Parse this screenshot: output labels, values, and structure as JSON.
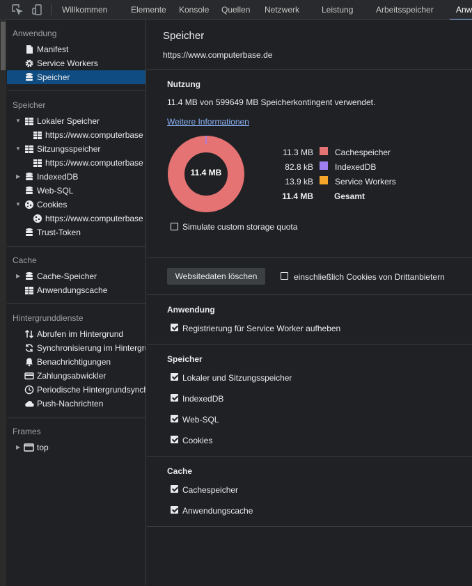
{
  "topbar": {
    "tabs": [
      "Willkommen",
      "Elemente",
      "Konsole",
      "Quellen",
      "Netzwerk",
      "Leistung",
      "Arbeitsspeicher",
      "Anwendung"
    ],
    "active_tab": "Anwendung",
    "active_tab_visible_text": "Anw"
  },
  "sidebar": {
    "sections": {
      "anwendung": "Anwendung",
      "speicher": "Speicher",
      "cache": "Cache",
      "hintergrund": "Hintergrunddienste",
      "frames": "Frames"
    },
    "anwendung_items": [
      "Manifest",
      "Service Workers",
      "Speicher"
    ],
    "selected_item": "Speicher",
    "speicher_items": [
      "Lokaler Speicher",
      "https://www.computerbase",
      "Sitzungsspeicher",
      "https://www.computerbase",
      "IndexedDB",
      "Web-SQL",
      "Cookies",
      "https://www.computerbase",
      "Trust-Token"
    ],
    "cache_items": [
      "Cache-Speicher",
      "Anwendungscache"
    ],
    "hintergrund_items": [
      "Abrufen im Hintergrund",
      "Synchronisierung im Hintergrund",
      "Benachrichtigungen",
      "Zahlungsabwickler",
      "Periodische Hintergrundsynchronisierung",
      "Push-Nachrichten"
    ],
    "frames_items": [
      "top"
    ]
  },
  "main": {
    "title": "Speicher",
    "origin": "https://www.computerbase.de",
    "usage": {
      "title": "Nutzung",
      "summary": "11.4 MB von 599649 MB Speicherkontingent verwendet.",
      "more_info_link": "Weitere Informationen",
      "donut_center": "11.4 MB",
      "legend": [
        {
          "value": "11.3 MB",
          "name": "Cachespeicher",
          "color": "#e57373"
        },
        {
          "value": "82.8 kB",
          "name": "IndexedDB",
          "color": "#9e7ff0"
        },
        {
          "value": "13.9 kB",
          "name": "Service Workers",
          "color": "#f4a52a"
        }
      ],
      "total_value": "11.4 MB",
      "total_label": "Gesamt",
      "simulate_quota_label": "Simulate custom storage quota",
      "simulate_quota_checked": false
    },
    "clear": {
      "button_label": "Websitedaten löschen",
      "third_party_label": "einschließlich Cookies von Drittanbietern",
      "third_party_checked": false
    },
    "application": {
      "title": "Anwendung",
      "options": [
        {
          "label": "Registrierung für Service Worker aufheben",
          "checked": true
        }
      ]
    },
    "storage": {
      "title": "Speicher",
      "options": [
        {
          "label": "Lokaler und Sitzungsspeicher",
          "checked": true
        },
        {
          "label": "IndexedDB",
          "checked": true
        },
        {
          "label": "Web-SQL",
          "checked": true
        },
        {
          "label": "Cookies",
          "checked": true
        }
      ]
    },
    "cache": {
      "title": "Cache",
      "options": [
        {
          "label": "Cachespeicher",
          "checked": true
        },
        {
          "label": "Anwendungscache",
          "checked": true
        }
      ]
    }
  },
  "colors": {
    "background": "#202124",
    "selected": "#0f4c81",
    "link": "#8ab4f8",
    "cache_storage": "#e57373",
    "indexeddb": "#9e7ff0",
    "service_workers": "#f4a52a"
  }
}
